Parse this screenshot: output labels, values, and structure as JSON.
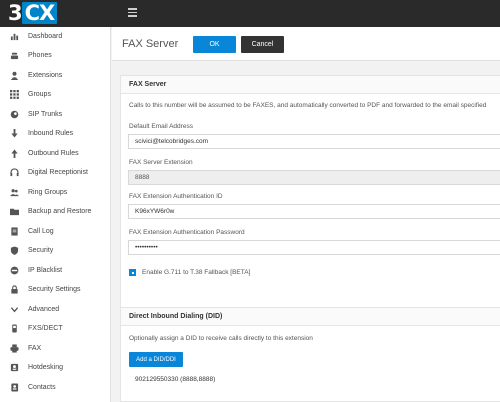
{
  "app": {
    "logo_num": "3",
    "logo_text": "CX"
  },
  "sidebar": {
    "items": [
      {
        "label": "Dashboard",
        "icon": "bar-chart-icon"
      },
      {
        "label": "Phones",
        "icon": "phone-icon"
      },
      {
        "label": "Extensions",
        "icon": "user-icon"
      },
      {
        "label": "Groups",
        "icon": "grid-icon"
      },
      {
        "label": "SIP Trunks",
        "icon": "globe-icon"
      },
      {
        "label": "Inbound Rules",
        "icon": "arrow-down-icon"
      },
      {
        "label": "Outbound Rules",
        "icon": "arrow-up-icon"
      },
      {
        "label": "Digital Receptionist",
        "icon": "headset-icon"
      },
      {
        "label": "Ring Groups",
        "icon": "users-icon"
      },
      {
        "label": "Backup and Restore",
        "icon": "folder-icon"
      },
      {
        "label": "Call Log",
        "icon": "document-icon"
      },
      {
        "label": "Security",
        "icon": "shield-icon"
      },
      {
        "label": "IP Blacklist",
        "icon": "block-icon"
      },
      {
        "label": "Security Settings",
        "icon": "lock-icon"
      },
      {
        "label": "Advanced",
        "icon": "chevron-down-icon"
      },
      {
        "label": "FXS/DECT",
        "icon": "device-icon"
      },
      {
        "label": "FAX",
        "icon": "fax-icon"
      },
      {
        "label": "Hotdesking",
        "icon": "hotdesk-icon"
      },
      {
        "label": "Contacts",
        "icon": "contacts-icon"
      }
    ]
  },
  "header": {
    "title": "FAX Server",
    "ok_label": "OK",
    "cancel_label": "Cancel"
  },
  "fax_panel": {
    "title": "FAX Server",
    "description": "Calls to this number will be assumed to be FAXES, and automatically converted to PDF and forwarded to the email specified",
    "email_label": "Default Email Address",
    "email_value": "scivici@telcobridges.com",
    "extension_label": "FAX Server Extension",
    "extension_value": "8888",
    "auth_id_label": "FAX Extension Authentication ID",
    "auth_id_value": "K96xYW6r0w",
    "auth_pw_label": "FAX Extension Authentication Password",
    "auth_pw_value": "••••••••••",
    "fallback_label": "Enable G.711 to T.38 Fallback [BETA]",
    "fallback_checked": true
  },
  "did_panel": {
    "title": "Direct Inbound Dialing (DID)",
    "description": "Optionally assign a DID to receive calls directly to this extension",
    "add_label": "Add a DID/DDI",
    "did_entry": "902129550330 (8888,8888)"
  },
  "colors": {
    "accent": "#0a86d8",
    "topbar": "#2a2a2a"
  }
}
